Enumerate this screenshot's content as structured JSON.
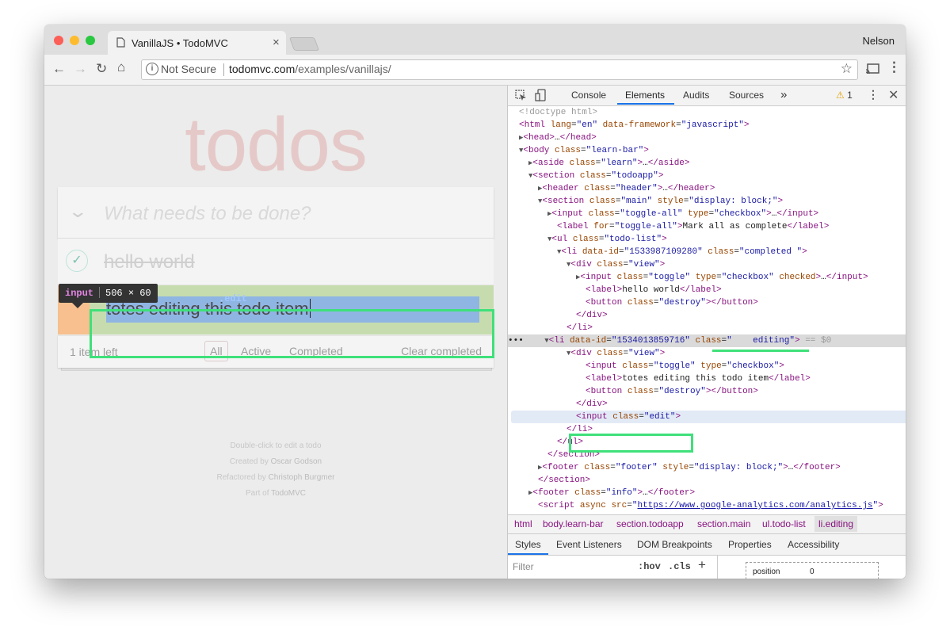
{
  "browser": {
    "tab_title": "VanillaJS • TodoMVC",
    "tab_close": "×",
    "profile": "Nelson",
    "security_status": "Not Secure",
    "url_host": "todomvc.com",
    "url_path": "/examples/vanillajs/",
    "colors": {
      "close": "#fc5f57",
      "minimize": "#fdbc2e",
      "maximize": "#29c840"
    }
  },
  "app": {
    "heading": "todos",
    "new_todo_placeholder": "What needs to be done?",
    "todos": [
      {
        "label": "hello world",
        "completed": true
      },
      {
        "label": "totes editing this todo item",
        "editing": true
      }
    ],
    "tooltip": {
      "tag": "input",
      "cls": ".edit",
      "size": "506 × 60"
    },
    "footer": {
      "count": "1 item left",
      "filters": [
        "All",
        "Active",
        "Completed"
      ],
      "clear": "Clear completed"
    },
    "info": {
      "line1": "Double-click to edit a todo",
      "line2_prefix": "Created by ",
      "line2_name": "Oscar Godson",
      "line3_prefix": "Refactored by ",
      "line3_name": "Christoph Burgmer",
      "line4_prefix": "Part of ",
      "line4_name": "TodoMVC"
    }
  },
  "devtools": {
    "tabs": [
      "Console",
      "Elements",
      "Audits",
      "Sources"
    ],
    "more_tabs": "»",
    "active_tab": "Elements",
    "warnings": "1",
    "breadcrumbs": [
      "html",
      "body.learn-bar",
      "section.todoapp",
      "section.main",
      "ul.todo-list",
      "li.editing"
    ],
    "subtabs": [
      "Styles",
      "Event Listeners",
      "DOM Breakpoints",
      "Properties",
      "Accessibility"
    ],
    "filter_placeholder": "Filter",
    "hov": ":hov",
    "cls": ".cls",
    "box_model": {
      "label": "position",
      "value": "0"
    }
  }
}
